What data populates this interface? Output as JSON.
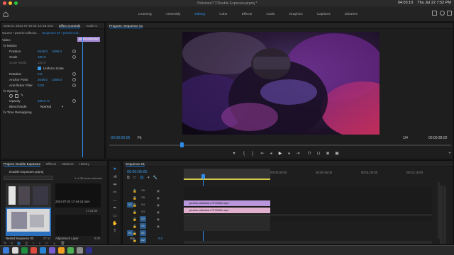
{
  "mac": {
    "title": "/Volumes/T7/Double Exposure.prproj *",
    "clock": "Thu Jul 22  7:52 PM",
    "record_time": "04:03:10"
  },
  "workspaces": [
    "Learning",
    "Assembly",
    "Editing",
    "Color",
    "Effects",
    "Audio",
    "Graphics",
    "Captions",
    "Libraries"
  ],
  "source_bar": {
    "source_tab": "Source: 2021-07-19 21-14-45.mov",
    "effect_controls_tab": "Effect Controls",
    "audio_tab": "Audio C"
  },
  "effect_controls": {
    "header_source": "Source * pexels-collectio...",
    "header_seq": "Sequence 01 * pexels-coll...",
    "clip_label": "pexels-collection",
    "video_label": "Video",
    "motion": "fx  Motion",
    "position_label": "Position",
    "position_x": "2048.0",
    "position_y": "1080.0",
    "scale_label": "Scale",
    "scale_val": "100.0",
    "scale_width_label": "Scale Width",
    "scale_width_val": "100.0",
    "uniform_label": "Uniform Scale",
    "rotation_label": "Rotation",
    "rotation_val": "0.0",
    "anchor_label": "Anchor Point",
    "anchor_x": "2048.0",
    "anchor_y": "1080.0",
    "flicker_label": "Anti-flicker Filter",
    "flicker_val": "0.00",
    "opacity": "fx  Opacity",
    "opacity_label": "Opacity",
    "opacity_val": "100.0 %",
    "blend_label": "Blend Mode",
    "blend_val": "Normal",
    "remap": "fx  Time Remapping",
    "timecode": "00:00:06:05"
  },
  "program": {
    "title": "Program: Sequence 01",
    "timecode": "00:00:06:05",
    "fit": "Fit",
    "quality": "1/4",
    "duration": "00:00:28:02"
  },
  "project": {
    "tab_project": "Project: Double Exposure",
    "tab_effects": "Effects",
    "tab_markers": "Markers",
    "tab_history": "History",
    "file": "Double Exposure.prproj",
    "count": "1 of 36 items selected",
    "item1_name": "Sequence 01",
    "item1_dur": "28:02",
    "item2_name": "2021-07-22 17-44-14.mov",
    "item2_dur": "17:22:00",
    "item3_name": "Nested Sequence 03",
    "item3_dur": "27:11",
    "item4_name": "Adjustment Layer",
    "item4_dur": "5:00"
  },
  "timeline": {
    "tab": "Sequence 01",
    "timecode": "00:00:06:00",
    "ruler": [
      ":00:00",
      "00:00:15:00",
      "00:00:30:00",
      "00:00:45:00",
      "00:01:00:00",
      "00:01:15:00"
    ],
    "tracks": [
      "V6",
      "V5",
      "V4",
      "V3",
      "V2",
      "V1",
      "A1",
      "A2",
      "A3"
    ],
    "clip_v2": "pexels-collection-7979406.mp4",
    "clip_v1": "pexels-collection-7979406.mp4",
    "mix_label": "Mix",
    "mix_val": "0.0"
  },
  "colors": {
    "accent": "#2d8ceb",
    "clip_purple": "#b996db",
    "clip_pink": "#e2b0cf"
  }
}
